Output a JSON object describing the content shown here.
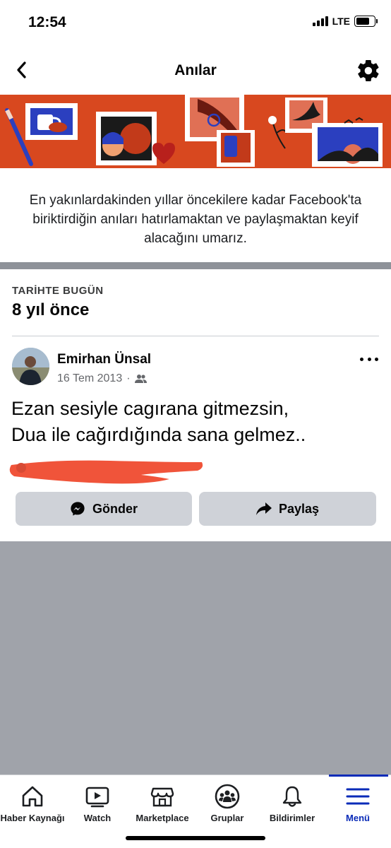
{
  "status_bar": {
    "time": "12:54",
    "network": "LTE",
    "battery_level": 0.75
  },
  "header": {
    "title": "Anılar",
    "back_icon": "chevron-left-icon",
    "settings_icon": "gear-icon"
  },
  "intro_text": "En yakınlardakinden yıllar öncekilere kadar Facebook'ta biriktirdiğin anıları hatırlamaktan ve paylaşmaktan keyif alacağını umarız.",
  "section": {
    "kicker": "TARİHTE BUGÜN",
    "title": "8 yıl önce"
  },
  "post": {
    "author": "Emirhan Ünsal",
    "date": "16 Tem 2013",
    "separator": "·",
    "audience_icon": "friends-icon",
    "text": "Ezan sesiyle cagırana gitmezsin,\nDua ile cağırdığında sana gelmez..",
    "send_label": "Gönder",
    "share_label": "Paylaş"
  },
  "colors": {
    "banner": "#d8481f",
    "accent": "#0a2bb8",
    "button_bg": "#cfd2d8",
    "redaction": "#f0543a"
  },
  "bottom_nav": {
    "items": [
      {
        "label": "Haber Kaynağı",
        "icon": "home-icon"
      },
      {
        "label": "Watch",
        "icon": "play-icon"
      },
      {
        "label": "Marketplace",
        "icon": "store-icon"
      },
      {
        "label": "Gruplar",
        "icon": "groups-icon"
      },
      {
        "label": "Bildirimler",
        "icon": "bell-icon"
      },
      {
        "label": "Menü",
        "icon": "menu-icon"
      }
    ],
    "active": "Menü"
  }
}
